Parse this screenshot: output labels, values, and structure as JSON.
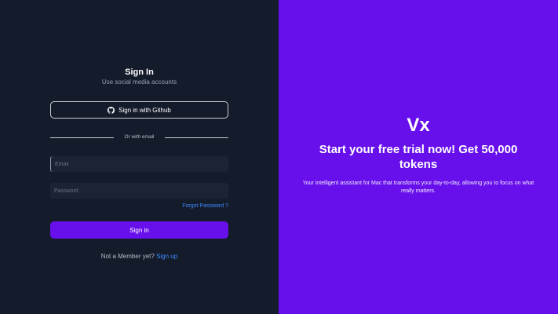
{
  "signin": {
    "title": "Sign In",
    "subtitle": "Use social media accounts",
    "github_label": "Sign in with Github",
    "divider_text": "Or with email",
    "email_placeholder": "Email",
    "password_placeholder": "Password",
    "forgot_label": "Forgot Password ?",
    "submit_label": "Sign in",
    "member_text": "Not a Member yet?",
    "signup_label": "Sign up"
  },
  "promo": {
    "brand": "Vx",
    "headline": "Start your free trial now! Get 50,000 tokens",
    "description": "Your intelligent assistant for Mac that transforms your day-to-day, allowing you to focus on what really matters."
  },
  "colors": {
    "background_dark": "#141b2b",
    "accent": "#6810ec",
    "link": "#3d8bfd",
    "field_bg": "#1c2333"
  },
  "icons": {
    "github": "github-icon"
  }
}
